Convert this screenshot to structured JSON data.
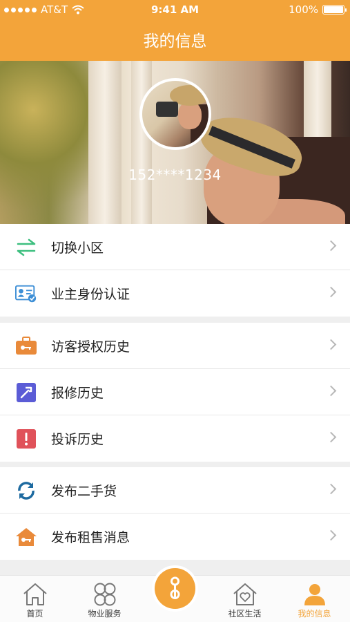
{
  "status_bar": {
    "carrier": "AT&T",
    "time": "9:41 AM",
    "battery": "100%"
  },
  "header": {
    "title": "我的信息"
  },
  "profile": {
    "phone": "152****1234"
  },
  "menu_groups": [
    [
      {
        "label": "切换小区",
        "icon": "switch-arrows-icon"
      },
      {
        "label": "业主身份认证",
        "icon": "id-card-verified-icon"
      }
    ],
    [
      {
        "label": "访客授权历史",
        "icon": "briefcase-key-icon"
      },
      {
        "label": "报修历史",
        "icon": "hammer-icon"
      },
      {
        "label": "投诉历史",
        "icon": "exclamation-icon"
      }
    ],
    [
      {
        "label": "发布二手货",
        "icon": "refresh-circle-icon"
      },
      {
        "label": "发布租售消息",
        "icon": "house-key-icon"
      }
    ]
  ],
  "tabbar": {
    "home": "首页",
    "property": "物业服务",
    "community": "社区生活",
    "mine": "我的信息"
  },
  "colors": {
    "accent": "#f3a43a",
    "green": "#3dbf7f",
    "blue": "#3d8fd6",
    "orange": "#e98a3a",
    "purple": "#5b5cd6",
    "red": "#e0525a",
    "teal": "#1d6aa0"
  }
}
